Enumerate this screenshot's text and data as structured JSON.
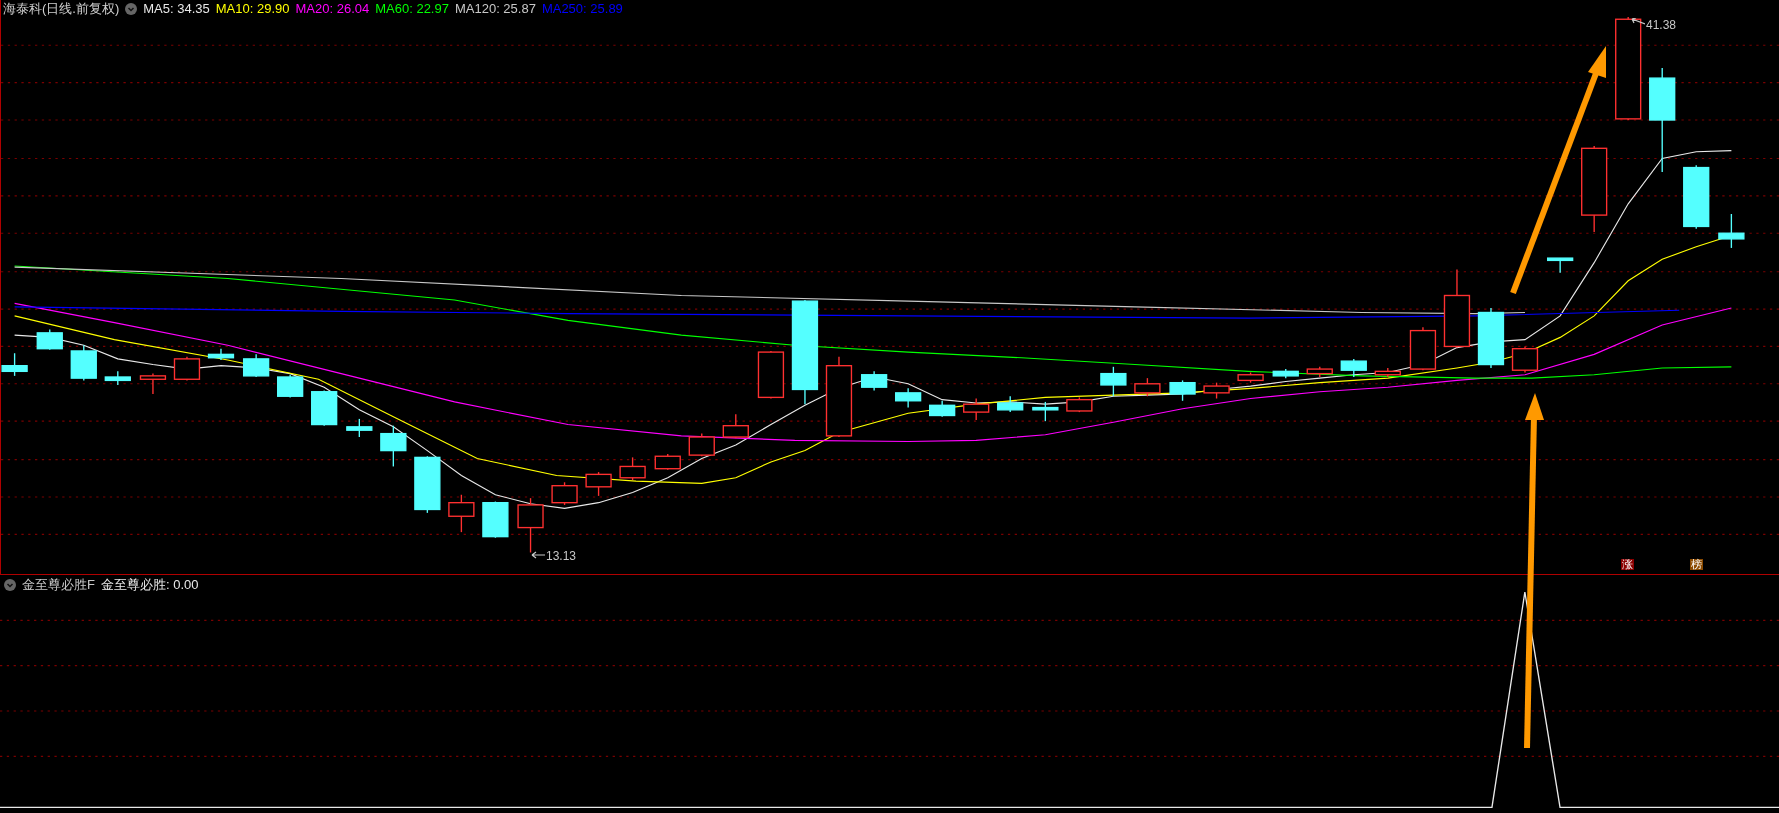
{
  "header": {
    "title": "海泰科(日线.前复权)",
    "ma": [
      {
        "label": "MA5: 34.35",
        "color": "#e8e8e8"
      },
      {
        "label": "MA10: 29.90",
        "color": "#ffff00"
      },
      {
        "label": "MA20: 26.04",
        "color": "#ff00ff"
      },
      {
        "label": "MA60: 22.97",
        "color": "#00ff00"
      },
      {
        "label": "MA120: 25.87",
        "color": "#c8c8c8"
      },
      {
        "label": "MA250: 25.89",
        "color": "#0000ff"
      }
    ]
  },
  "price_labels": {
    "high": "41.38",
    "low": "13.13"
  },
  "markers": [
    {
      "text": "涨",
      "color": "#8b0000"
    },
    {
      "text": "榜",
      "color": "#8b4a00"
    }
  ],
  "indicator": {
    "name": "金至尊必胜F",
    "reading": "金至尊必胜: 0.00"
  }
}
